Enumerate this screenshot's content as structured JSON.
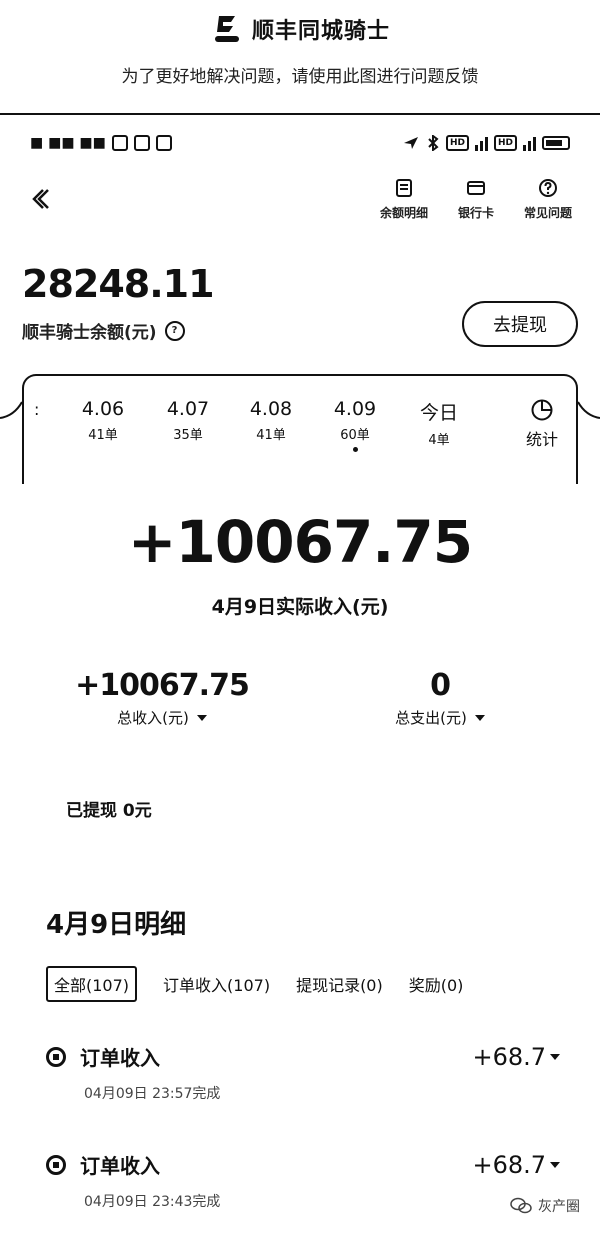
{
  "banner": {
    "app_name": "顺丰同城骑士",
    "subtitle": "为了更好地解决问题，请使用此图进行问题反馈"
  },
  "header": {
    "actions": [
      {
        "label": "余额明细",
        "icon": "receipt-icon"
      },
      {
        "label": "银行卡",
        "icon": "card-icon"
      },
      {
        "label": "常见问题",
        "icon": "question-icon"
      }
    ]
  },
  "balance": {
    "amount": "28248.11",
    "label": "顺丰骑士余额(元)",
    "withdraw_button": "去提现"
  },
  "date_tabs": [
    {
      "date": "4.06",
      "count": "41单",
      "selected": false
    },
    {
      "date": "4.07",
      "count": "35单",
      "selected": false
    },
    {
      "date": "4.08",
      "count": "41单",
      "selected": false
    },
    {
      "date": "4.09",
      "count": "60单",
      "selected": true
    },
    {
      "date": "今日",
      "count": "4单",
      "selected": false
    }
  ],
  "stats_tab": {
    "label": "统计",
    "icon": "clock-icon"
  },
  "day_income": {
    "amount": "+10067.75",
    "label": "4月9日实际收入(元)"
  },
  "totals": {
    "income_value": "+10067.75",
    "income_label": "总收入(元)",
    "expense_value": "0",
    "expense_label": "总支出(元)"
  },
  "withdrawn": "已提现 0元",
  "detail": {
    "title": "4月9日明细",
    "filters": [
      {
        "label": "全部(107)",
        "active": true
      },
      {
        "label": "订单收入(107)",
        "active": false
      },
      {
        "label": "提现记录(0)",
        "active": false
      },
      {
        "label": "奖励(0)",
        "active": false
      }
    ],
    "records": [
      {
        "title": "订单收入",
        "amount": "+68.7",
        "time": "04月09日 23:57完成"
      },
      {
        "title": "订单收入",
        "amount": "+68.7",
        "time": "04月09日 23:43完成"
      }
    ]
  },
  "watermark": "灰产圈"
}
